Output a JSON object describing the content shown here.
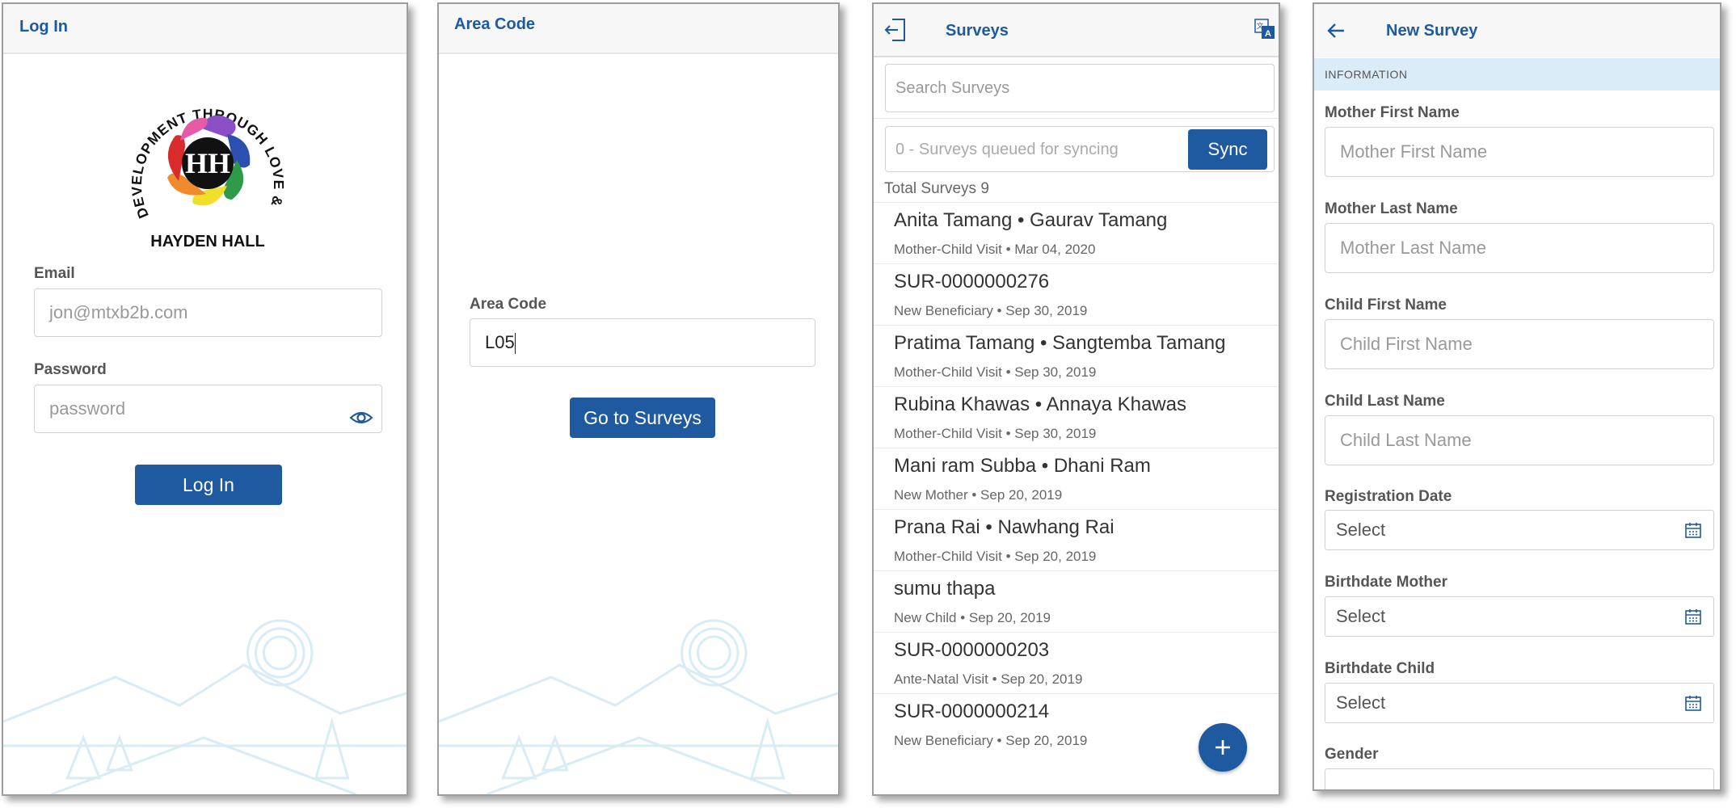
{
  "login": {
    "header_title": "Log In",
    "logo": {
      "arc_text": "HUMAN DEVELOPMENT THROUGH LOVE & SERVICE",
      "org_name": "HAYDEN HALL",
      "mark": "HH"
    },
    "email_label": "Email",
    "email_placeholder": "jon@mtxb2b.com",
    "password_label": "Password",
    "password_placeholder": "password",
    "login_button": "Log In"
  },
  "area_code": {
    "header_title": "Area Code",
    "field_label": "Area Code",
    "field_value": "L05",
    "go_button": "Go to Surveys"
  },
  "surveys": {
    "header_title": "Surveys",
    "search_placeholder": "Search Surveys",
    "queue_text": "0 - Surveys queued for syncing",
    "sync_button": "Sync",
    "total_text": "Total Surveys 9",
    "items": [
      {
        "title": "Anita Tamang • Gaurav Tamang",
        "subtitle": "Mother-Child Visit • Mar 04, 2020"
      },
      {
        "title": "SUR-0000000276",
        "subtitle": "New Beneficiary • Sep 30, 2019"
      },
      {
        "title": "Pratima Tamang • Sangtemba Tamang",
        "subtitle": "Mother-Child Visit • Sep 30, 2019"
      },
      {
        "title": "Rubina Khawas • Annaya Khawas",
        "subtitle": "Mother-Child Visit • Sep 30, 2019"
      },
      {
        "title": "Mani ram Subba • Dhani Ram",
        "subtitle": "New Mother • Sep 20, 2019"
      },
      {
        "title": "Prana Rai • Nawhang Rai",
        "subtitle": "Mother-Child Visit • Sep 20, 2019"
      },
      {
        "title": "sumu thapa",
        "subtitle": "New Child • Sep 20, 2019"
      },
      {
        "title": "SUR-0000000203",
        "subtitle": "Ante-Natal Visit • Sep 20, 2019"
      },
      {
        "title": "SUR-0000000214",
        "subtitle": "New Beneficiary • Sep 20, 2019"
      }
    ],
    "icons": {
      "logout": "logout-icon",
      "translate": "translate-icon",
      "add": "add-icon"
    }
  },
  "new_survey": {
    "header_title": "New Survey",
    "section_title": "INFORMATION",
    "mother_first_name_label": "Mother First Name",
    "mother_first_name_placeholder": "Mother First Name",
    "mother_last_name_label": "Mother Last Name",
    "mother_last_name_placeholder": "Mother Last Name",
    "child_first_name_label": "Child First Name",
    "child_first_name_placeholder": "Child First Name",
    "child_last_name_label": "Child Last Name",
    "child_last_name_placeholder": "Child Last Name",
    "registration_date_label": "Registration Date",
    "registration_date_value": "Select",
    "birthdate_mother_label": "Birthdate Mother",
    "birthdate_mother_value": "Select",
    "birthdate_child_label": "Birthdate Child",
    "birthdate_child_value": "Select",
    "gender_label": "Gender"
  },
  "colors": {
    "brand_blue": "#1f5aa0",
    "header_bg": "#f7f7f7",
    "section_bg": "#d9ecf7"
  }
}
